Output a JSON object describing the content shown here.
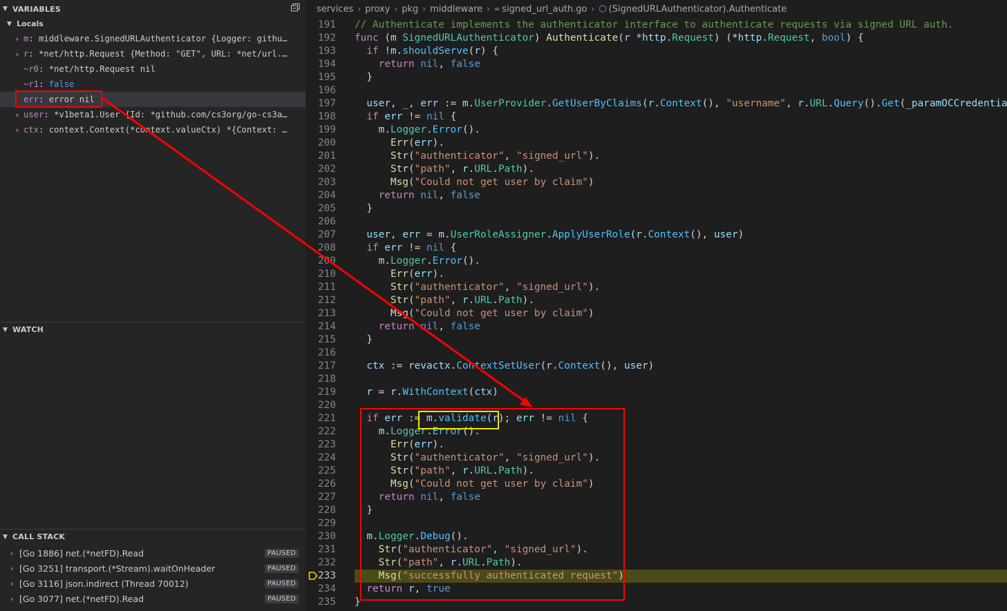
{
  "sidebar": {
    "variables_title": "VARIABLES",
    "locals_label": "Locals",
    "variables": [
      {
        "name": "m",
        "value": "middleware.SignedURLAuthenticator {Logger: githu…",
        "expandable": true
      },
      {
        "name": "r",
        "value": "*net/http.Request {Method: \"GET\", URL: *net/url.…",
        "expandable": true
      },
      {
        "name": "~r0",
        "value": "*net/http.Request nil",
        "expandable": false
      },
      {
        "name": "~r1",
        "value": "false",
        "expandable": false
      },
      {
        "name": "err",
        "value": "error nil",
        "expandable": false
      },
      {
        "name": "user",
        "value": "*v1beta1.User {Id: *github.com/cs3org/go-cs3a…",
        "expandable": true
      },
      {
        "name": "ctx",
        "value": "context.Context(*context.valueCtx) *{Context: …",
        "expandable": true
      }
    ],
    "watch_title": "WATCH",
    "callstack_title": "CALL STACK",
    "callstack": [
      {
        "label": "[Go 1886] net.(*netFD).Read",
        "status": "PAUSED"
      },
      {
        "label": "[Go 3251] transport.(*Stream).waitOnHeader",
        "status": "PAUSED"
      },
      {
        "label": "[Go 3116] json.indirect (Thread 70012)",
        "status": "PAUSED"
      },
      {
        "label": "[Go 3077] net.(*netFD).Read",
        "status": "PAUSED"
      }
    ]
  },
  "breadcrumb": [
    "services",
    "proxy",
    "pkg",
    "middleware",
    "signed_url_auth.go",
    "(SignedURLAuthenticator).Authenticate"
  ],
  "editor": {
    "current_line": "233",
    "lines": [
      {
        "n": "191",
        "t": "// Authenticate implements the authenticator interface to authenticate requests via signed URL auth."
      },
      {
        "n": "192",
        "t": "func (m SignedURLAuthenticator) Authenticate(r *http.Request) (*http.Request, bool) {"
      },
      {
        "n": "193",
        "t": "  if !m.shouldServe(r) {"
      },
      {
        "n": "194",
        "t": "    return nil, false"
      },
      {
        "n": "195",
        "t": "  }"
      },
      {
        "n": "196",
        "t": ""
      },
      {
        "n": "197",
        "t": "  user, _, err := m.UserProvider.GetUserByClaims(r.Context(), \"username\", r.URL.Query().Get(_paramOCCredential))"
      },
      {
        "n": "198",
        "t": "  if err != nil {"
      },
      {
        "n": "199",
        "t": "    m.Logger.Error()."
      },
      {
        "n": "200",
        "t": "      Err(err)."
      },
      {
        "n": "201",
        "t": "      Str(\"authenticator\", \"signed_url\")."
      },
      {
        "n": "202",
        "t": "      Str(\"path\", r.URL.Path)."
      },
      {
        "n": "203",
        "t": "      Msg(\"Could not get user by claim\")"
      },
      {
        "n": "204",
        "t": "    return nil, false"
      },
      {
        "n": "205",
        "t": "  }"
      },
      {
        "n": "206",
        "t": ""
      },
      {
        "n": "207",
        "t": "  user, err = m.UserRoleAssigner.ApplyUserRole(r.Context(), user)"
      },
      {
        "n": "208",
        "t": "  if err != nil {"
      },
      {
        "n": "209",
        "t": "    m.Logger.Error()."
      },
      {
        "n": "210",
        "t": "      Err(err)."
      },
      {
        "n": "211",
        "t": "      Str(\"authenticator\", \"signed_url\")."
      },
      {
        "n": "212",
        "t": "      Str(\"path\", r.URL.Path)."
      },
      {
        "n": "213",
        "t": "      Msg(\"Could not get user by claim\")"
      },
      {
        "n": "214",
        "t": "    return nil, false"
      },
      {
        "n": "215",
        "t": "  }"
      },
      {
        "n": "216",
        "t": ""
      },
      {
        "n": "217",
        "t": "  ctx := revactx.ContextSetUser(r.Context(), user)"
      },
      {
        "n": "218",
        "t": ""
      },
      {
        "n": "219",
        "t": "  r = r.WithContext(ctx)"
      },
      {
        "n": "220",
        "t": ""
      },
      {
        "n": "221",
        "t": "  if err := m.validate(r); err != nil {"
      },
      {
        "n": "222",
        "t": "    m.Logger.Error()."
      },
      {
        "n": "223",
        "t": "      Err(err)."
      },
      {
        "n": "224",
        "t": "      Str(\"authenticator\", \"signed_url\")."
      },
      {
        "n": "225",
        "t": "      Str(\"path\", r.URL.Path)."
      },
      {
        "n": "226",
        "t": "      Msg(\"Could not get user by claim\")"
      },
      {
        "n": "227",
        "t": "    return nil, false"
      },
      {
        "n": "228",
        "t": "  }"
      },
      {
        "n": "229",
        "t": ""
      },
      {
        "n": "230",
        "t": "  m.Logger.Debug()."
      },
      {
        "n": "231",
        "t": "    Str(\"authenticator\", \"signed_url\")."
      },
      {
        "n": "232",
        "t": "    Str(\"path\", r.URL.Path)."
      },
      {
        "n": "233",
        "t": "    Msg(\"successfully authenticated request\")"
      },
      {
        "n": "234",
        "t": "  return r, true"
      },
      {
        "n": "235",
        "t": "}"
      }
    ]
  },
  "colors": {
    "annotation_red": "#ff0000",
    "annotation_yellow": "#f2e600",
    "current_line_bg": "#4b4b18"
  }
}
